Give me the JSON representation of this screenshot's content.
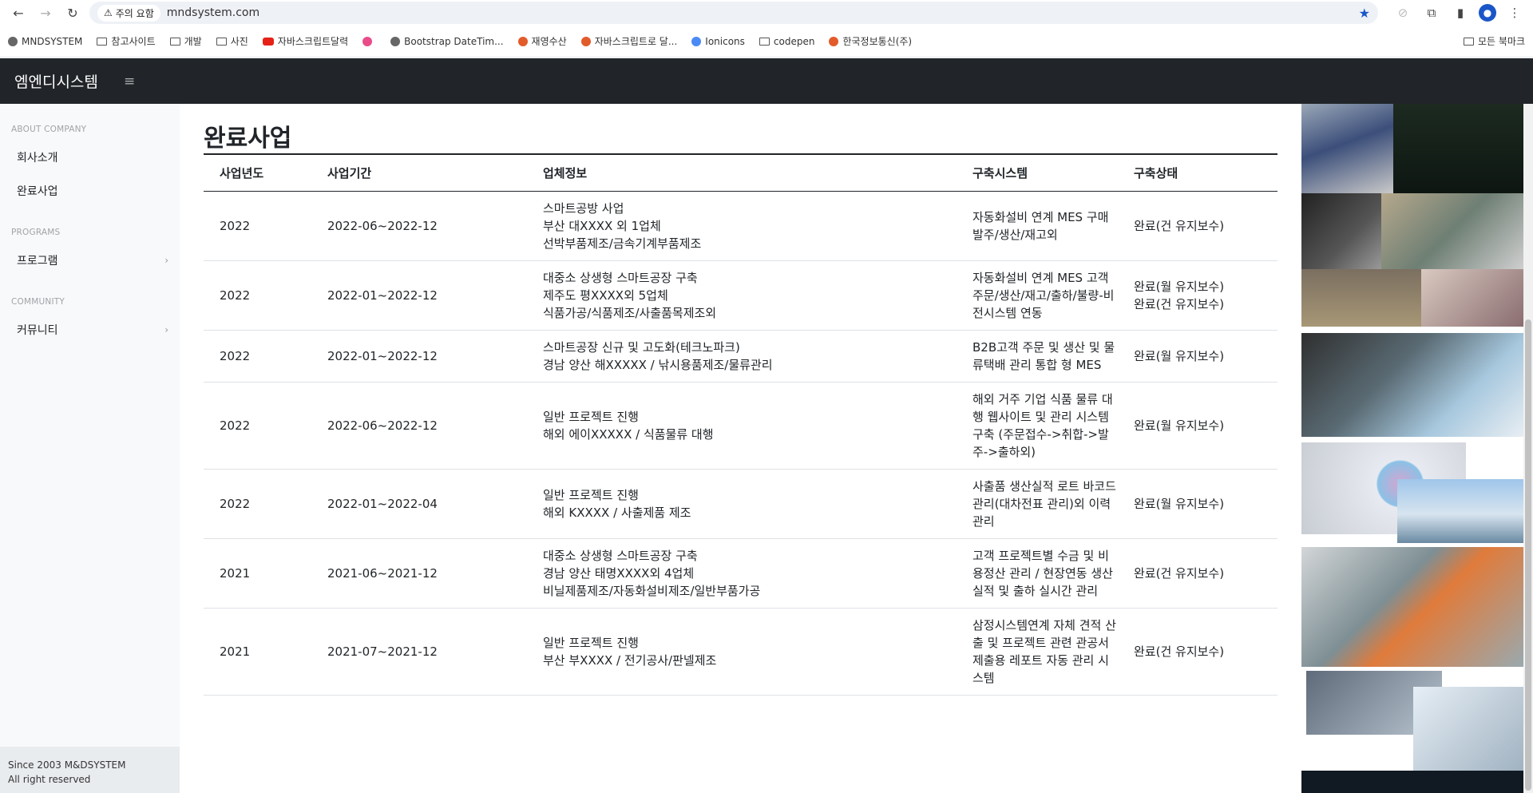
{
  "browser": {
    "warning_label": "주의 요함",
    "url": "mndsystem.com",
    "bookmarks": [
      {
        "label": "MNDSYSTEM",
        "icon": "globe-icon"
      },
      {
        "label": "참고사이트",
        "icon": "folder-icon"
      },
      {
        "label": "개발",
        "icon": "folder-icon"
      },
      {
        "label": "사진",
        "icon": "folder-icon"
      },
      {
        "label": "자바스크립트달력",
        "icon": "youtube-icon"
      },
      {
        "label": "",
        "icon": "dribbble-icon"
      },
      {
        "label": "Bootstrap DateTim...",
        "icon": "globe-icon"
      },
      {
        "label": "재영수산",
        "icon": "site-icon"
      },
      {
        "label": "자바스크립트로 달...",
        "icon": "site-icon"
      },
      {
        "label": "Ionicons",
        "icon": "ionicons-icon"
      },
      {
        "label": "codepen",
        "icon": "folder-icon"
      },
      {
        "label": "한국정보통신(주)",
        "icon": "site-icon"
      }
    ],
    "all_bookmarks_label": "모든 북마크"
  },
  "header": {
    "brand": "엠엔디시스템"
  },
  "sidebar": {
    "sections": [
      {
        "heading": "ABOUT COMPANY",
        "items": [
          {
            "label": "회사소개",
            "has_submenu": false
          },
          {
            "label": "완료사업",
            "has_submenu": false
          }
        ]
      },
      {
        "heading": "PROGRAMS",
        "items": [
          {
            "label": "프로그램",
            "has_submenu": true
          }
        ]
      },
      {
        "heading": "COMMUNITY",
        "items": [
          {
            "label": "커뮤니티",
            "has_submenu": true
          }
        ]
      }
    ],
    "footer_line1": "Since 2003 M&DSYSTEM",
    "footer_line2": "All right reserved"
  },
  "main": {
    "title": "완료사업",
    "columns": [
      "사업년도",
      "사업기간",
      "업체정보",
      "구축시스템",
      "구축상태"
    ],
    "rows": [
      {
        "year": "2022",
        "period": "2022-06~2022-12",
        "company": [
          "스마트공방 사업",
          "부산 대XXXX 외 1업체",
          "선박부품제조/금속기계부품제조"
        ],
        "system": "자동화설비 연계 MES 구매발주/생산/재고외",
        "status": [
          "완료(건 유지보수)"
        ]
      },
      {
        "year": "2022",
        "period": "2022-01~2022-12",
        "company": [
          "대중소 상생형 스마트공장 구축",
          "제주도 평XXXX외 5업체",
          "식품가공/식품제조/사출품목제조외"
        ],
        "system": "자동화설비 연계 MES 고객주문/생산/재고/출하/불량-비전시스템 연동",
        "status": [
          "완료(월 유지보수)",
          "완료(건 유지보수)"
        ]
      },
      {
        "year": "2022",
        "period": "2022-01~2022-12",
        "company": [
          "스마트공장 신규 및 고도화(테크노파크)",
          "경남 양산 해XXXXX / 낚시용품제조/물류관리"
        ],
        "system": "B2B고객 주문 및 생산 및 물류택배 관리 통합 형 MES",
        "status": [
          "완료(월 유지보수)"
        ]
      },
      {
        "year": "2022",
        "period": "2022-06~2022-12",
        "company": [
          "일반 프로젝트 진행",
          "해외 에이XXXXX / 식품물류 대행"
        ],
        "system": "해외 거주 기업 식품 물류 대행 웹사이트 및 관리 시스템 구축 (주문접수->취합->발주->출하외)",
        "status": [
          "완료(월 유지보수)"
        ]
      },
      {
        "year": "2022",
        "period": "2022-01~2022-04",
        "company": [
          "일반 프로젝트 진행",
          "해외 KXXXX / 사출제품 제조"
        ],
        "system": "사출품 생산실적 로트 바코드 관리(대차전표 관리)외 이력관리",
        "status": [
          "완료(월 유지보수)"
        ]
      },
      {
        "year": "2021",
        "period": "2021-06~2021-12",
        "company": [
          "대중소 상생형 스마트공장 구축",
          "경남 양산 태명XXXX외 4업체",
          "비닐제품제조/자동화설비제조/일반부품가공"
        ],
        "system": "고객 프로젝트별 수금 및 비용정산 관리 / 현장연동 생산 실적 및 출하 실시간 관리",
        "status": [
          "완료(건 유지보수)"
        ]
      },
      {
        "year": "2021",
        "period": "2021-07~2021-12",
        "company": [
          "일반 프로젝트 진행",
          "부산 부XXXX / 전기공사/판넬제조"
        ],
        "system": "삼정시스템연계 자체 견적 산출 및 프로젝트 관련 관공서 제출용 레포트 자동 관리 시스템",
        "status": [
          "완료(건 유지보수)"
        ]
      }
    ]
  }
}
